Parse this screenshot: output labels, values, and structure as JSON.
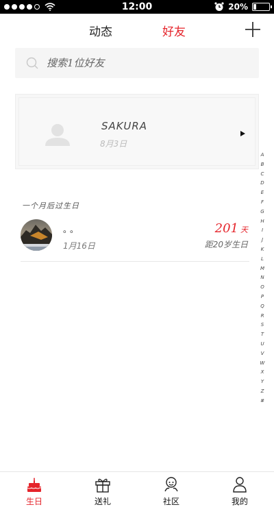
{
  "status_bar": {
    "time": "12:00",
    "battery_text": "20%",
    "battery_level": 0.2,
    "signal_dots_filled": 4,
    "signal_dots_total": 5
  },
  "header": {
    "tabs": [
      {
        "label": "动态",
        "active": false
      },
      {
        "label": "好友",
        "active": true
      }
    ],
    "add_icon": "plus-icon"
  },
  "search": {
    "placeholder": "搜索1位好友",
    "icon": "search-icon"
  },
  "featured": {
    "name": "SAKURA",
    "date": "8月3日",
    "avatar_icon": "person-silhouette-icon",
    "arrow_icon": "play-arrow-icon"
  },
  "section": {
    "title": "一个月后过生日"
  },
  "friends": [
    {
      "name": "。。",
      "date": "1月16日",
      "days": "201",
      "days_unit": "天",
      "age_text": "距20岁生日"
    }
  ],
  "index_letters": [
    "A",
    "B",
    "C",
    "D",
    "E",
    "F",
    "G",
    "H",
    "I",
    "J",
    "K",
    "L",
    "M",
    "N",
    "O",
    "P",
    "Q",
    "R",
    "S",
    "T",
    "U",
    "V",
    "W",
    "X",
    "Y",
    "Z",
    "#"
  ],
  "bottom_nav": [
    {
      "label": "生日",
      "icon": "birthday-cake-icon",
      "active": true
    },
    {
      "label": "送礼",
      "icon": "gift-icon",
      "active": false
    },
    {
      "label": "社区",
      "icon": "community-icon",
      "active": false
    },
    {
      "label": "我的",
      "icon": "user-icon",
      "active": false
    }
  ],
  "colors": {
    "accent": "#e5242b",
    "text": "#222222",
    "muted": "#bbbbbb",
    "search_bg": "#f5f5f5"
  }
}
